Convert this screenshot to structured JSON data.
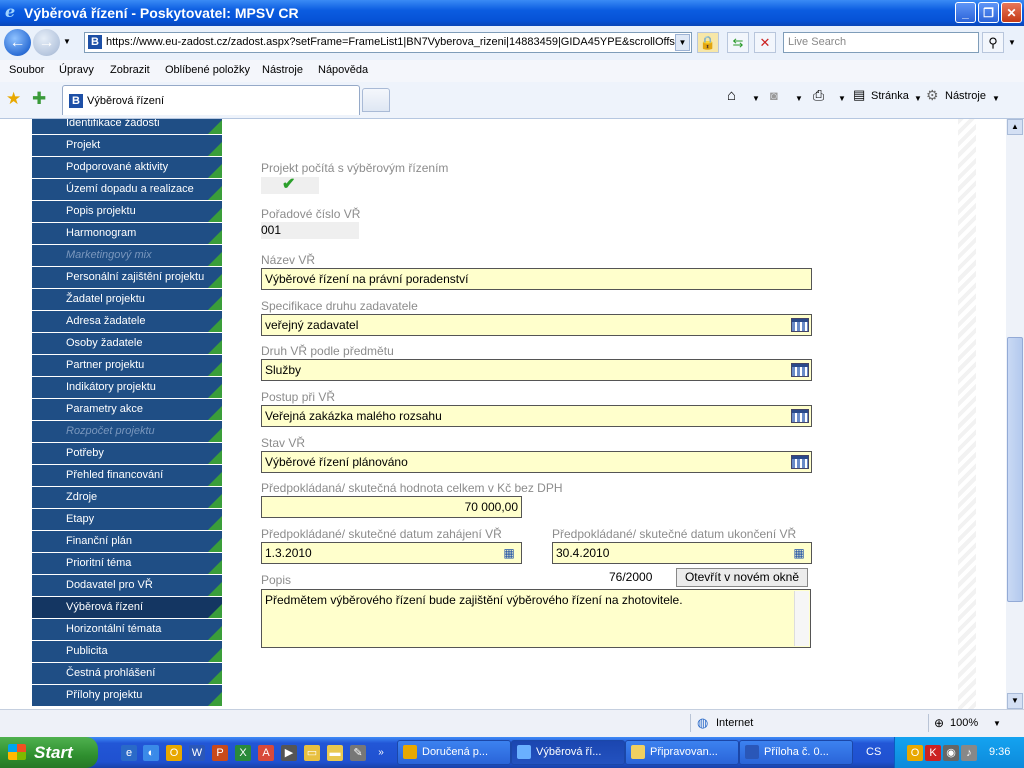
{
  "window": {
    "title": "Výběrová řízení - Poskytovatel: MPSV CR",
    "buttons": [
      "minimize",
      "maximize",
      "close"
    ]
  },
  "address_bar": {
    "url": "https://www.eu-zadost.cz/zadost.aspx?setFrame=FrameList1|BN7Vyberova_rizeni|14883459|GIDA45YPE&scrollOffse",
    "search_placeholder": "Live Search"
  },
  "menu": [
    "Soubor",
    "Úpravy",
    "Zobrazit",
    "Oblíbené položky",
    "Nástroje",
    "Nápověda"
  ],
  "tab": {
    "label": "Výběrová řízení"
  },
  "toolbar": {
    "page_label": "Stránka",
    "tools_label": "Nástroje"
  },
  "sidebar": {
    "items": [
      {
        "label": "Identifikace žádosti",
        "state": "normal"
      },
      {
        "label": "Projekt",
        "state": "normal"
      },
      {
        "label": "Podporované aktivity",
        "state": "normal"
      },
      {
        "label": "Území dopadu a realizace",
        "state": "normal"
      },
      {
        "label": "Popis projektu",
        "state": "normal"
      },
      {
        "label": "Harmonogram",
        "state": "normal"
      },
      {
        "label": "Marketingový mix",
        "state": "disabled"
      },
      {
        "label": "Personální zajištění projektu",
        "state": "normal"
      },
      {
        "label": "Žadatel projektu",
        "state": "normal"
      },
      {
        "label": "Adresa žadatele",
        "state": "normal"
      },
      {
        "label": "Osoby žadatele",
        "state": "normal"
      },
      {
        "label": "Partner projektu",
        "state": "normal"
      },
      {
        "label": "Indikátory projektu",
        "state": "normal"
      },
      {
        "label": "Parametry akce",
        "state": "normal"
      },
      {
        "label": "Rozpočet projektu",
        "state": "disabled"
      },
      {
        "label": "Potřeby",
        "state": "normal"
      },
      {
        "label": "Přehled financování",
        "state": "normal"
      },
      {
        "label": "Zdroje",
        "state": "normal"
      },
      {
        "label": "Etapy",
        "state": "normal"
      },
      {
        "label": "Finanční plán",
        "state": "normal"
      },
      {
        "label": "Prioritní téma",
        "state": "normal"
      },
      {
        "label": "Dodavatel pro VŘ",
        "state": "normal"
      },
      {
        "label": "Výběrová řízení",
        "state": "active"
      },
      {
        "label": "Horizontální témata",
        "state": "normal"
      },
      {
        "label": "Publicita",
        "state": "normal"
      },
      {
        "label": "Čestná prohlášení",
        "state": "normal"
      },
      {
        "label": "Přílohy projektu",
        "state": "normal"
      }
    ]
  },
  "form": {
    "tender_flag_label": "Projekt počítá s výběrovým řízením",
    "tender_flag_checked": true,
    "order_label": "Pořadové číslo VŘ",
    "order_value": "001",
    "name_label": "Název VŘ",
    "name_value": "Výběrové řízení na právní poradenství",
    "spec_label": "Specifikace druhu zadavatele",
    "spec_value": "veřejný zadavatel",
    "type_label": "Druh VŘ podle předmětu",
    "type_value": "Služby",
    "procedure_label": "Postup při VŘ",
    "procedure_value": "Veřejná zakázka malého rozsahu",
    "status_label": "Stav VŘ",
    "status_value": "Výběrové řízení plánováno",
    "amount_label": "Předpokládaná/ skutečná hodnota celkem v Kč bez DPH",
    "amount_value": "70 000,00",
    "start_label": "Předpokládané/ skutečné datum zahájení VŘ",
    "start_value": "1.3.2010",
    "end_label": "Předpokládané/ skutečné datum ukončení VŘ",
    "end_value": "30.4.2010",
    "desc_label": "Popis",
    "desc_counter": "76/2000",
    "open_button": "Otevřít v novém okně",
    "desc_value": "Předmětem výběrového řízení bude zajištění výběrového řízení na zhotovitele."
  },
  "status_bar": {
    "zone": "Internet",
    "zoom": "100%"
  },
  "taskbar": {
    "start_label": "Start",
    "tasks": [
      {
        "label": "Doručená p...",
        "active": false
      },
      {
        "label": "Výběrová ří...",
        "active": true
      },
      {
        "label": "Připravovan...",
        "active": false
      },
      {
        "label": "Příloha č. 0...",
        "active": false
      }
    ],
    "lang": "CS",
    "clock": "9:36"
  }
}
